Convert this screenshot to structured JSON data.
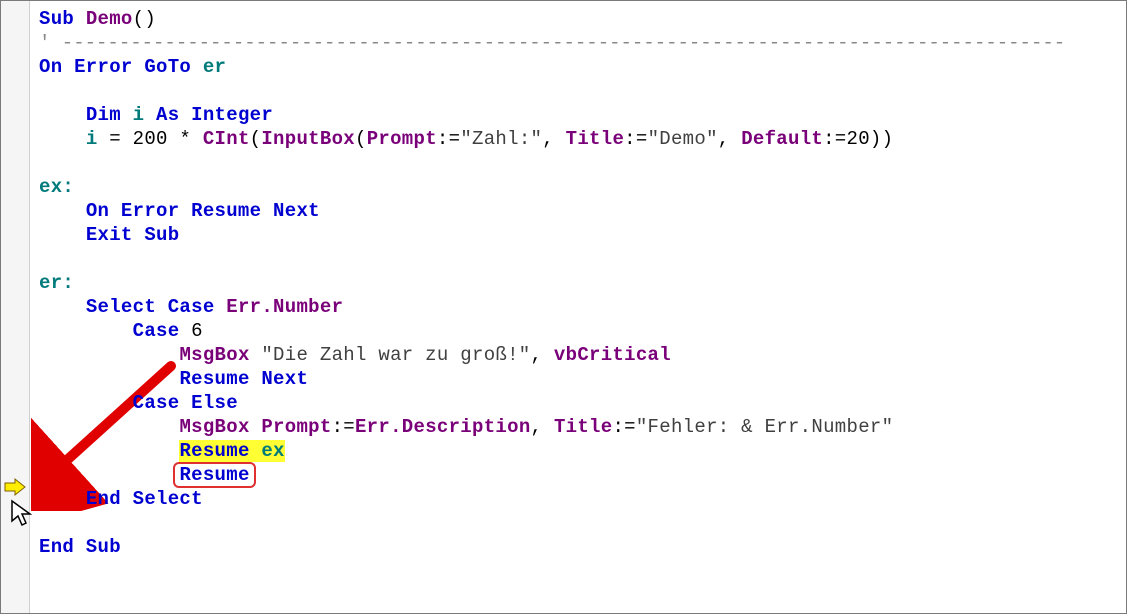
{
  "code": {
    "sub_kw": "Sub",
    "sub_name": "Demo",
    "sub_parens": "()",
    "divider": "' ----------------------------------------------------------------------------------------",
    "on_error_goto": "On Error GoTo",
    "er_label_ref": "er",
    "dim_kw": "Dim",
    "var_i": "i",
    "as_kw": "As",
    "int_type": "Integer",
    "assign_left": "i = 200 * ",
    "cint_fn": "CInt",
    "inputbox_fn": "InputBox",
    "prompt_kw": "Prompt",
    "prompt_val": "\"Zahl:\"",
    "title_kw": "Title",
    "title_val1": "\"Demo\"",
    "default_kw": "Default",
    "default_val": "20",
    "ex_label": "ex:",
    "on_error_resume_next": "On Error Resume Next",
    "exit_sub": "Exit Sub",
    "er_label": "er:",
    "select_case": "Select Case",
    "err_obj": "Err",
    "number_prop": ".Number",
    "case_kw": "Case",
    "case6_num": "6",
    "msgbox_fn": "MsgBox",
    "msg1": "\"Die Zahl war zu groß!\"",
    "vbcritical": "vbCritical",
    "resume_next": "Resume Next",
    "else_kw": "Else",
    "desc_prop": ".Description",
    "title_val2": "\"Fehler: & Err.Number\"",
    "resume_ex": "Resume ex",
    "resume_only": "Resume",
    "end_select": "End Select",
    "end_sub": "End Sub"
  },
  "annotations": {
    "exec_arrow": "execution-pointer",
    "cursor": "mouse-cursor",
    "red_arrow": "red-annotation-arrow"
  }
}
